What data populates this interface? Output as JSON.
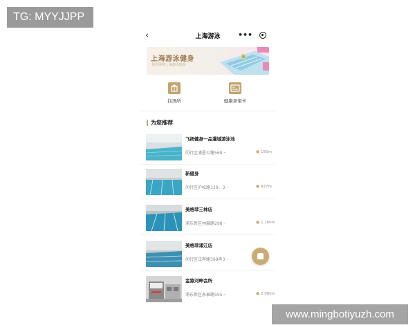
{
  "watermarks": {
    "top_left": "TG: MYYJJPP",
    "bottom_right": "www.mingbotiyuzh.com"
  },
  "nav": {
    "back_icon": "chevron-left-icon",
    "title": "上海游泳",
    "more_icon": "more-dots-icon",
    "target_icon": "target-icon"
  },
  "banner": {
    "title": "上海游泳健身",
    "subtitle": "和你便携上海游泳健身"
  },
  "quick": [
    {
      "label": "找场所",
      "icon": "building-icon"
    },
    {
      "label": "健康承诺卡",
      "icon": "card-icon"
    }
  ],
  "section": {
    "title": "为您推荐"
  },
  "venues": [
    {
      "name": "飞扬健身一品漫城游泳池",
      "address": "闵行区浦星公路568···",
      "distance": "180m"
    },
    {
      "name": "新健身",
      "address": "闵行区沪松路330、3···",
      "distance": "927m"
    },
    {
      "name": "美格菲三林店",
      "address": "浦东新区林展路298···",
      "distance": "1.16km"
    },
    {
      "name": "美格菲浦江店",
      "address": "闵行区江桦路399弄3···",
      "distance": ""
    },
    {
      "name": "金猿河畔会所",
      "address": "浦东新区永泰路595···",
      "distance": "2.08km"
    }
  ],
  "colors": {
    "accent": "#c7a66c",
    "banner_title": "#a07a52"
  }
}
